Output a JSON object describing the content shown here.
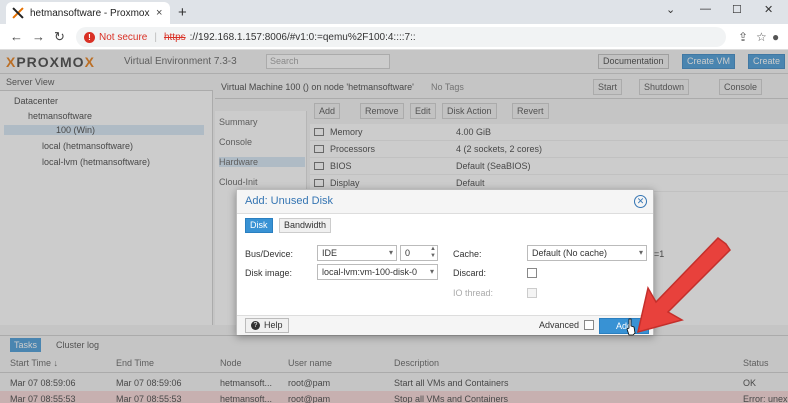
{
  "browser": {
    "tab_title": "hetmansoftware - Proxmox Virtu",
    "tab_close": "×",
    "new_tab": "+",
    "window_controls": [
      "⌄",
      "—",
      "☐",
      "✕"
    ],
    "not_secure": "Not secure",
    "url_https": "https",
    "url_rest": "://192.168.1.157:8006/#v1:0:=qemu%2F100:4::::7::",
    "icons": [
      "back-arrow-icon",
      "forward-arrow-icon",
      "reload-icon",
      "warning-icon",
      "share-icon",
      "star-icon",
      "profile-icon"
    ]
  },
  "header": {
    "logo_prefix": "P",
    "logo_x": "X",
    "logo_main": "PROXMO",
    "logo_suffix": "X",
    "ve_text": "Virtual Environment 7.3-3",
    "search_placeholder": "Search",
    "documentation": "Documentation",
    "create_vm": "Create VM",
    "create_ct": "Create"
  },
  "server_view": {
    "label": "Server View",
    "tree": [
      "Datacenter",
      "hetmansoftware",
      "100 (Win)",
      "local (hetmansoftware)",
      "local-lvm (hetmansoftware)"
    ]
  },
  "vm": {
    "title": "Virtual Machine 100 () on node 'hetmansoftware'",
    "tags": "No Tags",
    "start": "Start",
    "shutdown": "Shutdown",
    "console": "Console",
    "menu": [
      "Summary",
      "Console",
      "Hardware",
      "Cloud-Init"
    ],
    "toolbar": [
      "Add",
      "Remove",
      "Edit",
      "Disk Action",
      "Revert"
    ],
    "hardware": [
      {
        "key": "Memory",
        "value": "4.00 GiB"
      },
      {
        "key": "Processors",
        "value": "4 (2 sockets, 2 cores)"
      },
      {
        "key": "BIOS",
        "value": "Default (SeaBIOS)"
      },
      {
        "key": "Display",
        "value": "Default"
      }
    ],
    "partial_value": "=1"
  },
  "tasks": {
    "tabs": [
      "Tasks",
      "Cluster log"
    ],
    "columns": [
      "Start Time ↓",
      "End Time",
      "Node",
      "User name",
      "Description",
      "Status"
    ],
    "rows": [
      {
        "start": "Mar 07 08:59:06",
        "end": "Mar 07 08:59:06",
        "node": "hetmansoft...",
        "user": "root@pam",
        "desc": "Start all VMs and Containers",
        "status": "OK"
      },
      {
        "start": "Mar 07 08:55:53",
        "end": "Mar 07 08:55:53",
        "node": "hetmansoft...",
        "user": "root@pam",
        "desc": "Stop all VMs and Containers",
        "status": "Error: unex"
      }
    ]
  },
  "dialog": {
    "title": "Add: Unused Disk",
    "tabs": [
      "Disk",
      "Bandwidth"
    ],
    "bus_label": "Bus/Device:",
    "bus_value": "IDE",
    "device_value": "0",
    "disk_image_label": "Disk image:",
    "disk_image_value": "local-lvm:vm-100-disk-0",
    "cache_label": "Cache:",
    "cache_value": "Default (No cache)",
    "discard_label": "Discard:",
    "io_thread_label": "IO thread:",
    "help": "Help",
    "advanced": "Advanced",
    "add": "Add"
  },
  "colors": {
    "accent": "#3892d4",
    "title_blue": "#3575b3",
    "arrow_red": "#e8413c",
    "logo_orange": "#e57000"
  }
}
